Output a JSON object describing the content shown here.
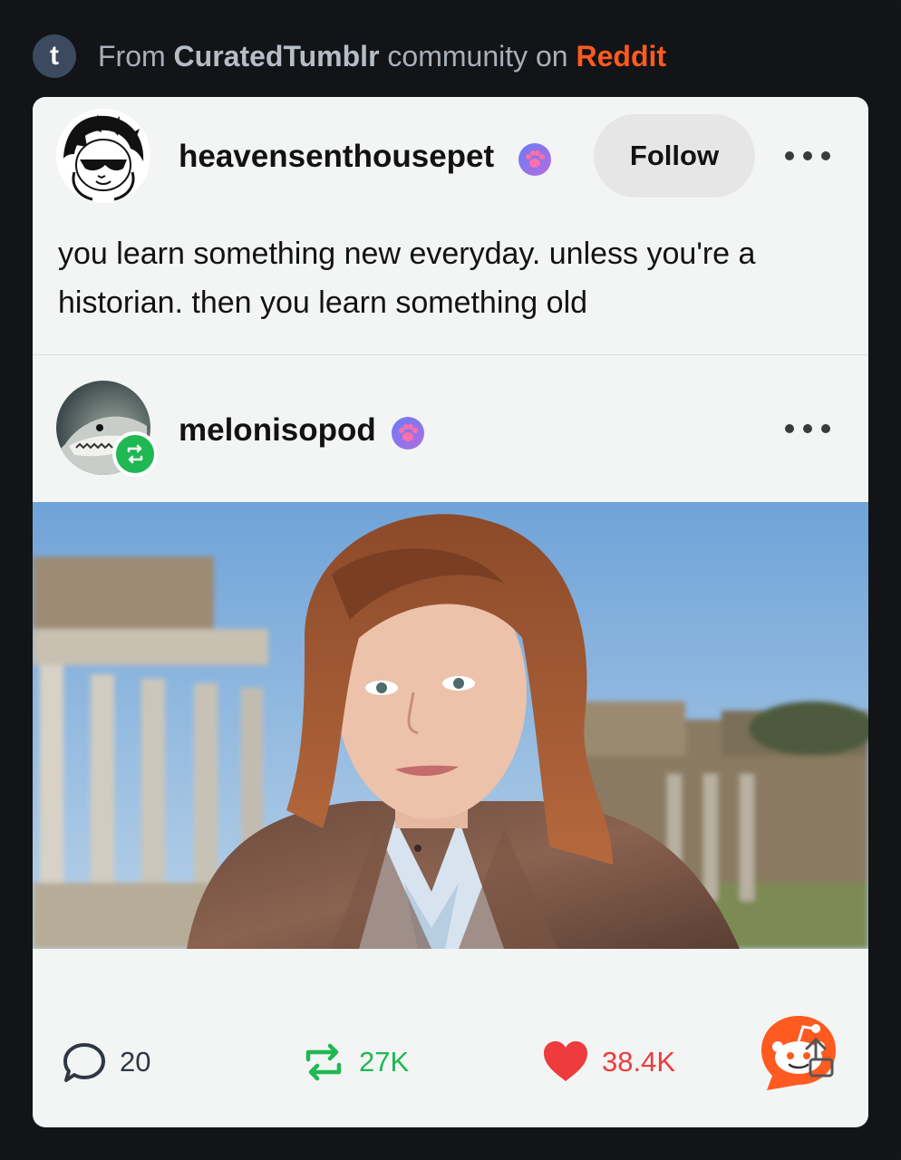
{
  "source": {
    "from_label": "From",
    "community": "CuratedTumblr",
    "mid_label": "community on",
    "platform": "Reddit",
    "badge_letter": "t",
    "accent_color": "#ff5a1f"
  },
  "post": {
    "username": "heavensenthousepet",
    "follow_label": "Follow",
    "text": "you learn something new everyday. unless you're a historian. then you learn something old"
  },
  "reblog": {
    "username": "melonisopod"
  },
  "stats": {
    "comments": "20",
    "reblogs": "27K",
    "likes": "38.4K",
    "reblog_color": "#1fb853",
    "like_color": "#ee3b3b"
  },
  "icons": {
    "more": "more-dots-icon",
    "badge": "paw-badge-icon",
    "comment": "comment-bubble-icon",
    "reblog": "reblog-arrows-icon",
    "like": "heart-icon",
    "reddit": "reddit-snoo-icon"
  }
}
